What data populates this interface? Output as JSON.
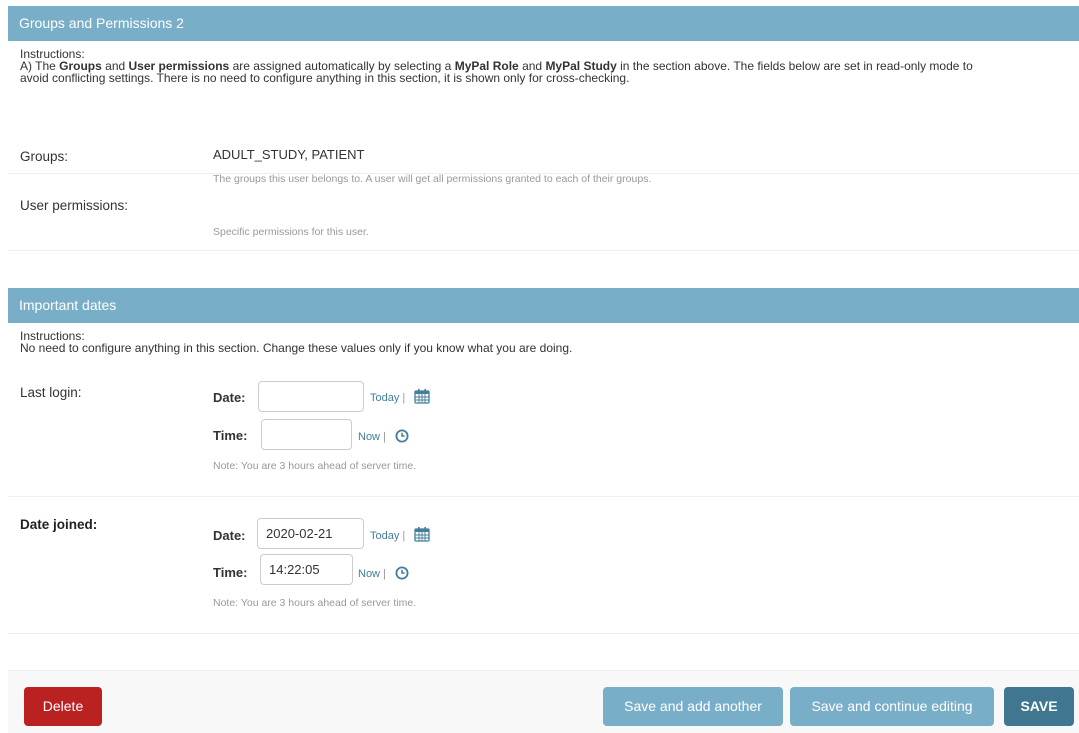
{
  "groups_section": {
    "header": "Groups and Permissions 2",
    "instructions_title": "Instructions:",
    "instr_line1_a": "A) The ",
    "instr_groups": "Groups",
    "instr_and": " and ",
    "instr_user_permissions": "User permissions",
    "instr_line1_b": " are assigned automatically by selecting a ",
    "instr_mypal_role": "MyPal Role",
    "instr_and2": " and ",
    "instr_mypal_study": "MyPal Study",
    "instr_line1_c": " in the section above. The fields below are set in read-only mode to",
    "instr_line2": "avoid conflicting settings. There is no need to configure anything in this section, it is shown only for cross-checking.",
    "groups_label": "Groups:",
    "groups_value": "ADULT_STUDY, PATIENT",
    "groups_help": "The groups this user belongs to. A user will get all permissions granted to each of their groups.",
    "perms_label": "User permissions:",
    "perms_help": "Specific permissions for this user."
  },
  "dates_section": {
    "header": "Important dates",
    "instructions_title": "Instructions:",
    "instr_line": "No need to configure anything in this section. Change these values only if you know what you are doing.",
    "last_login": {
      "label": "Last login:",
      "date_label": "Date:",
      "date_value": "",
      "time_label": "Time:",
      "time_value": "",
      "today": "Today",
      "now": "Now",
      "sep": " | ",
      "note": "Note: You are 3 hours ahead of server time."
    },
    "date_joined": {
      "label": "Date joined:",
      "date_label": "Date:",
      "date_value": "2020-02-21",
      "time_label": "Time:",
      "time_value": "14:22:05",
      "today": "Today",
      "now": "Now",
      "sep": " | ",
      "note": "Note: You are 3 hours ahead of server time."
    }
  },
  "submit_row": {
    "delete": "Delete",
    "save_add": "Save and add another",
    "save_continue": "Save and continue editing",
    "save": "SAVE"
  },
  "icons": {
    "calendar": "calendar-icon",
    "clock": "clock-icon"
  },
  "colors": {
    "header_bg": "#79aec8",
    "link": "#447e9b",
    "delete": "#ba2121",
    "save": "#417690"
  }
}
